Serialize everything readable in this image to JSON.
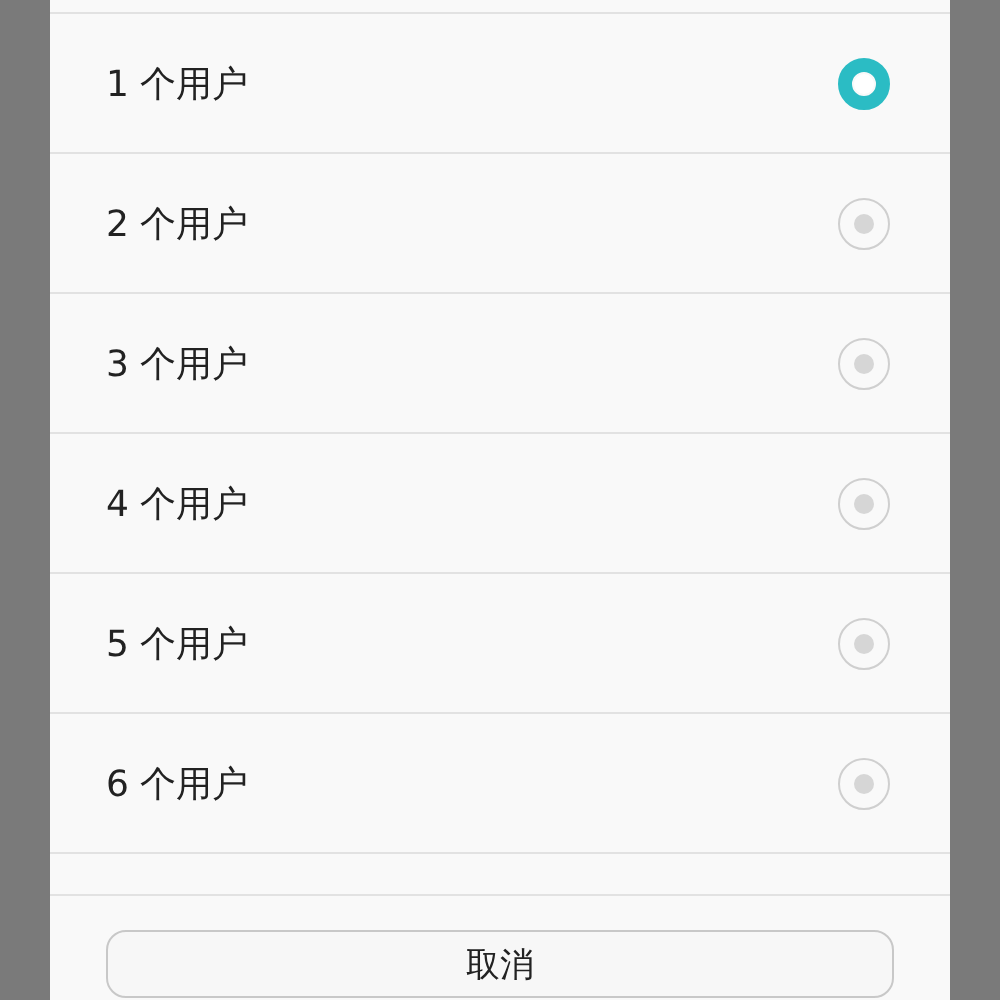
{
  "options": [
    {
      "label": "1 个用户",
      "selected": true
    },
    {
      "label": "2 个用户",
      "selected": false
    },
    {
      "label": "3 个用户",
      "selected": false
    },
    {
      "label": "4 个用户",
      "selected": false
    },
    {
      "label": "5 个用户",
      "selected": false
    },
    {
      "label": "6 个用户",
      "selected": false
    }
  ],
  "cancel_button": "取消"
}
